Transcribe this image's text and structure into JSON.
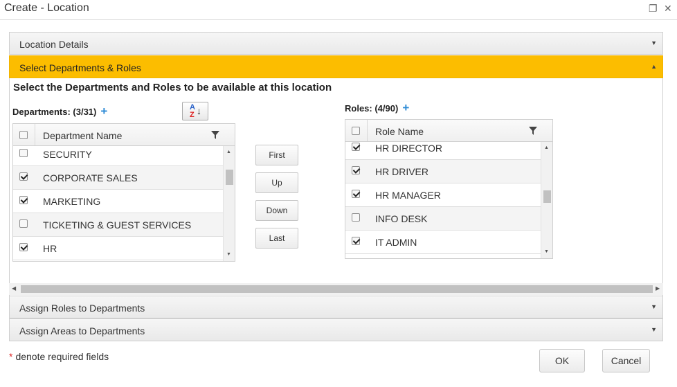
{
  "window": {
    "title": "Create - Location",
    "maximize_glyph": "❐",
    "close_glyph": "✕"
  },
  "accordion": {
    "location_details": "Location Details",
    "select_depts_roles": "Select Departments & Roles",
    "assign_roles": "Assign Roles to Departments",
    "assign_areas": "Assign Areas to Departments"
  },
  "arrows": {
    "collapsed": "▼",
    "expanded": "▲"
  },
  "heading": "Select the Departments and Roles to be available at this location",
  "departments": {
    "label": "Departments: (3/31)",
    "plus": "+",
    "column": "Department Name",
    "rows": [
      {
        "name": "SECURITY",
        "checked": false
      },
      {
        "name": "CORPORATE SALES",
        "checked": true
      },
      {
        "name": "MARKETING",
        "checked": true
      },
      {
        "name": "TICKETING & GUEST SERVICES",
        "checked": false
      },
      {
        "name": "HR",
        "checked": true
      }
    ]
  },
  "roles": {
    "label": "Roles: (4/90)",
    "plus": "+",
    "column": "Role Name",
    "rows": [
      {
        "name": "HR DIRECTOR",
        "checked": true
      },
      {
        "name": "HR DRIVER",
        "checked": true
      },
      {
        "name": "HR MANAGER",
        "checked": true
      },
      {
        "name": "INFO DESK",
        "checked": false
      },
      {
        "name": "IT ADMIN",
        "checked": true
      }
    ]
  },
  "sort_button": {
    "a": "A",
    "z": "Z",
    "arrow": "↓"
  },
  "move_buttons": {
    "first": "First",
    "up": "Up",
    "down": "Down",
    "last": "Last"
  },
  "footer": {
    "required_star": "*",
    "required_note": "denote required fields",
    "ok": "OK",
    "cancel": "Cancel"
  },
  "colors": {
    "accent": "#fcbd00",
    "plus": "#2e8bd6",
    "required": "#dd2222"
  },
  "icons": [
    "maximize-icon",
    "close-icon",
    "filter-icon",
    "sort-az-icon",
    "chevron-down-icon",
    "chevron-up-icon"
  ]
}
